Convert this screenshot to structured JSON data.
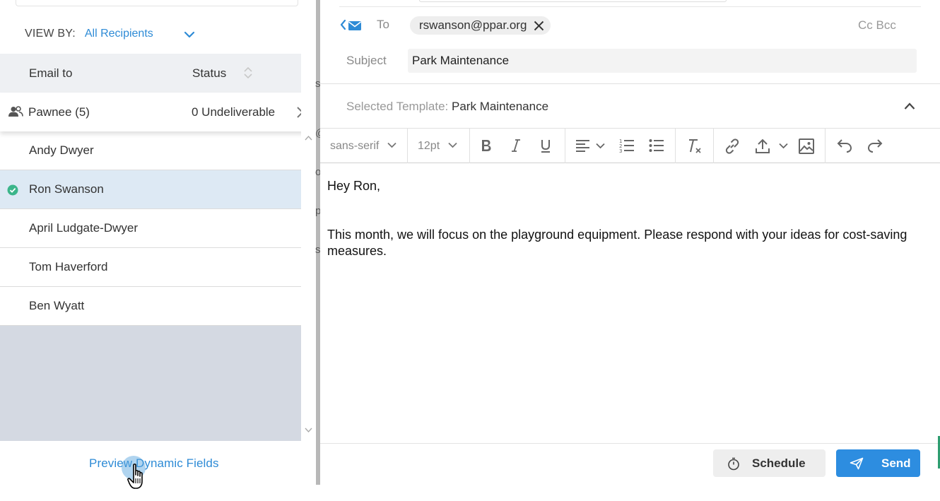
{
  "left_panel": {
    "view_by_label": "VIEW BY:",
    "view_by_value": "All Recipients",
    "columns": {
      "email_to": "Email to",
      "status": "Status"
    },
    "group": {
      "name": "Pawnee (5)",
      "status": "0 Undeliverable"
    },
    "recipients": [
      {
        "name": "Andy Dwyer",
        "selected": false
      },
      {
        "name": "Ron Swanson",
        "selected": true
      },
      {
        "name": "April Ludgate-Dwyer",
        "selected": false
      },
      {
        "name": "Tom Haverford",
        "selected": false
      },
      {
        "name": "Ben Wyatt",
        "selected": false
      }
    ],
    "preview_link": "Preview Dynamic Fields",
    "peek_chars": [
      "s",
      "@",
      "o",
      "p",
      "s"
    ]
  },
  "compose": {
    "to_label": "To",
    "to_recipient": "rswanson@ppar.org",
    "cc_bcc": "Cc Bcc",
    "subject_label": "Subject",
    "subject_value": "Park Maintenance",
    "template_label": "Selected Template:",
    "template_value": "Park Maintenance",
    "toolbar": {
      "font_family": "sans-serif",
      "font_size": "12pt"
    },
    "body": {
      "greeting": "Hey Ron,",
      "paragraph": "This month, we will focus on the playground equipment. Please respond with your ideas for cost-saving measures."
    },
    "schedule_label": "Schedule",
    "send_label": "Send"
  },
  "colors": {
    "accent": "#2e8bd6",
    "send": "#2d8de0",
    "selected_row": "#dde9f4",
    "check": "#3bb58a"
  },
  "icons": [
    "chevron-down-icon",
    "sort-icon",
    "group-icon",
    "close-icon",
    "check-circle-icon",
    "scroll-up-icon",
    "scroll-down-icon",
    "hand-cursor-icon",
    "mail-icon",
    "chevron-up-icon",
    "bold-icon",
    "italic-icon",
    "underline-icon",
    "align-icon",
    "numbered-list-icon",
    "bullet-list-icon",
    "clear-format-icon",
    "link-icon",
    "upload-icon",
    "image-icon",
    "undo-icon",
    "redo-icon",
    "timer-icon",
    "send-icon"
  ]
}
